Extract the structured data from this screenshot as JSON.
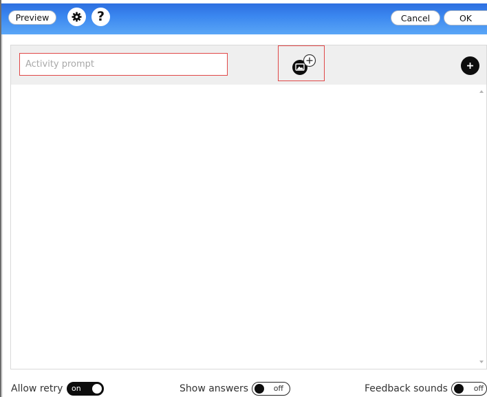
{
  "toolbar": {
    "preview_label": "Preview",
    "settings_icon": "gear-icon",
    "help_icon": "question-icon",
    "cancel_label": "Cancel",
    "ok_label": "OK"
  },
  "editor": {
    "prompt_placeholder": "Activity prompt",
    "prompt_value": "",
    "add_image_icon": "image-add-icon",
    "add_item_icon": "plus-icon"
  },
  "options": {
    "allow_retry": {
      "label": "Allow retry",
      "state": "on"
    },
    "show_answers": {
      "label": "Show answers",
      "state": "off"
    },
    "feedback_sounds": {
      "label": "Feedback sounds",
      "state": "off"
    }
  },
  "colors": {
    "toolbar_top": "#2d6fe0",
    "toolbar_bottom": "#5aa6f6",
    "highlight": "#e04646",
    "prompt_bar": "#efefef"
  }
}
